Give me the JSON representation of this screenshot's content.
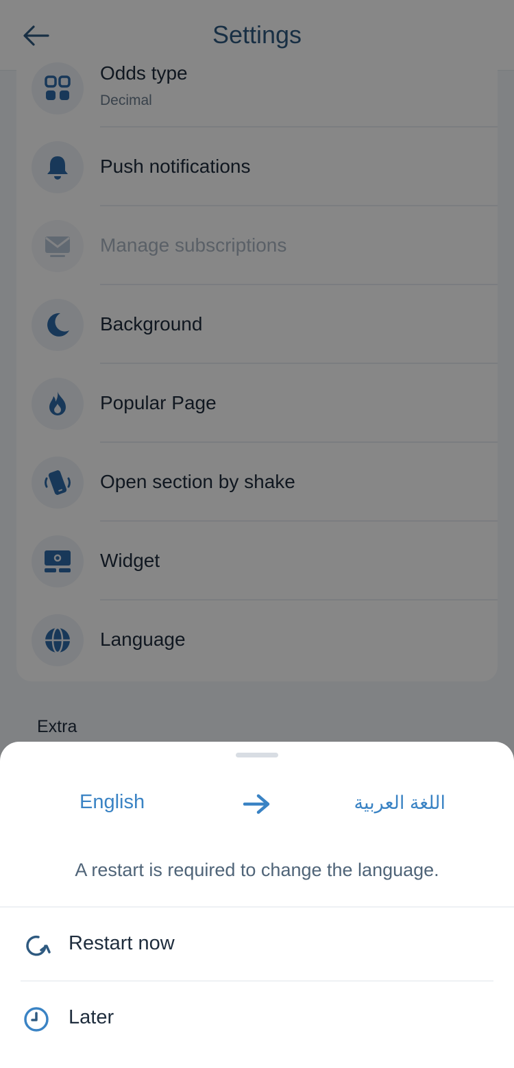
{
  "header": {
    "title": "Settings"
  },
  "settings": {
    "items": [
      {
        "label": "Odds type",
        "sublabel": "Decimal",
        "icon": "grid-icon"
      },
      {
        "label": "Push notifications",
        "icon": "bell-icon"
      },
      {
        "label": "Manage subscriptions",
        "icon": "mail-icon",
        "disabled": true
      },
      {
        "label": "Background",
        "icon": "moon-icon"
      },
      {
        "label": "Popular Page",
        "icon": "fire-icon"
      },
      {
        "label": "Open section by shake",
        "icon": "shake-phone-icon"
      },
      {
        "label": "Widget",
        "icon": "widget-icon"
      },
      {
        "label": "Language",
        "icon": "globe-icon"
      }
    ],
    "extra_title": "Extra"
  },
  "sheet": {
    "from_language": "English",
    "to_language": "اللغة العربية",
    "notice": "A restart is required to change the language.",
    "options": [
      {
        "label": "Restart now",
        "icon": "restart-icon"
      },
      {
        "label": "Later",
        "icon": "clock-icon"
      }
    ]
  },
  "colors": {
    "accent": "#3a83c4",
    "title": "#2f5a80",
    "icon_fill": "#2e6ba8"
  }
}
